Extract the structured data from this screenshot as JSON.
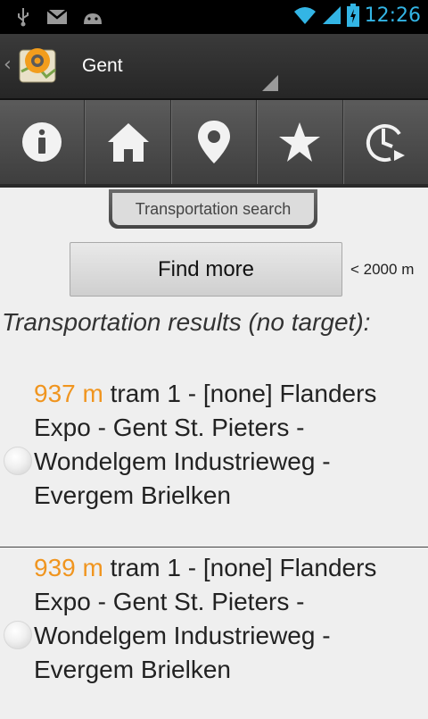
{
  "status_bar": {
    "time": "12:26"
  },
  "action_bar": {
    "title": "Gent"
  },
  "tab": {
    "label": "Transportation search"
  },
  "controls": {
    "find_more_label": "Find more",
    "radius_label": "< 2000 m"
  },
  "results": {
    "title": "Transportation results (no target):",
    "items": [
      {
        "distance": "937 m",
        "line": " tram 1 - [none]",
        "route": "Flanders Expo - Gent St. Pieters - Wondelgem Industrieweg - Evergem Brielken"
      },
      {
        "distance": "939 m",
        "line": " tram 1 - [none]",
        "route": "Flanders Expo - Gent St. Pieters - Wondelgem Industrieweg - Evergem Brielken"
      }
    ]
  },
  "colors": {
    "distance": "#f0951f",
    "clock": "#33b5e5"
  }
}
